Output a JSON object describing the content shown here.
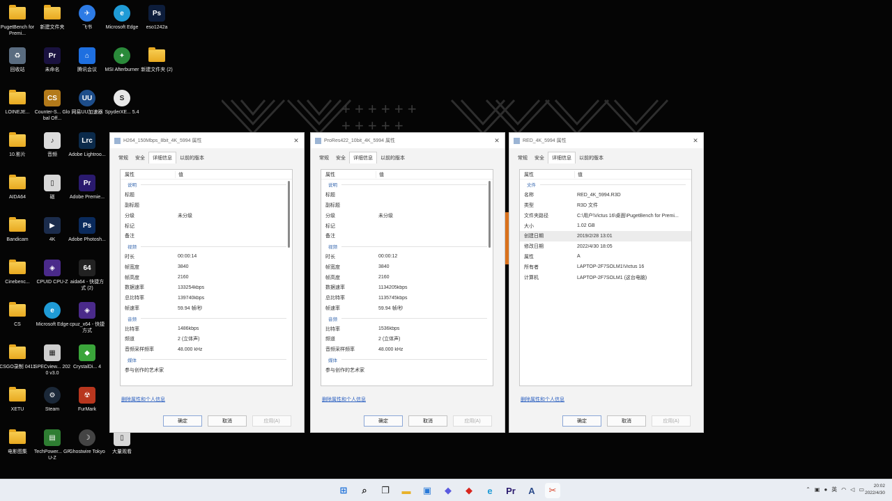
{
  "desktop": {
    "icons": [
      {
        "label": "PugetBench for Premi...",
        "icon": "folder-icon"
      },
      {
        "label": "新建文件夹",
        "icon": "folder-icon"
      },
      {
        "label": "飞书",
        "icon": "feishu-icon"
      },
      {
        "label": "Microsoft Edge",
        "icon": "edge-icon"
      },
      {
        "label": "eso1242a",
        "icon": "photoshop-file-icon"
      },
      {
        "label": "回收站",
        "icon": "recycle-bin-icon"
      },
      {
        "label": "未命名",
        "icon": "premiere-file-icon"
      },
      {
        "label": "腾讯会议",
        "icon": "tencent-meeting-icon"
      },
      {
        "label": "MSI Afterburner",
        "icon": "afterburner-icon"
      },
      {
        "label": "新建文件夹 (2)",
        "icon": "folder-icon"
      },
      {
        "label": "LOINEJE...",
        "icon": "folder-icon"
      },
      {
        "label": "Counter-S... Global Off...",
        "icon": "csgo-icon"
      },
      {
        "label": "网易UU加速器",
        "icon": "uu-accelerator-icon"
      },
      {
        "label": "SpyderXE... 5.4",
        "icon": "spyder-icon"
      },
      {
        "label": "10.影片",
        "icon": "folder-icon"
      },
      {
        "label": "音频",
        "icon": "audio-file-icon"
      },
      {
        "label": "Adobe Lightroo...",
        "icon": "lightroom-icon"
      },
      {
        "label": "AIDA64",
        "icon": "folder-icon"
      },
      {
        "label": "磁",
        "icon": "file-icon"
      },
      {
        "label": "Adobe Premie...",
        "icon": "premiere-icon"
      },
      {
        "label": "Bandicam",
        "icon": "folder-icon"
      },
      {
        "label": "4K",
        "icon": "video-file-icon"
      },
      {
        "label": "Adobe Photosh...",
        "icon": "photoshop-icon"
      },
      {
        "label": "Cinebenc...",
        "icon": "folder-icon"
      },
      {
        "label": "CPUID CPU-Z",
        "icon": "cpuz-icon"
      },
      {
        "label": "aida64 - 快捷方式 (2)",
        "icon": "aida64-icon"
      },
      {
        "label": "CS",
        "icon": "folder-icon"
      },
      {
        "label": "Microsoft Edge",
        "icon": "edge-icon"
      },
      {
        "label": "cpuz_x64 - 快捷方式",
        "icon": "cpuz-icon"
      },
      {
        "label": "CSGO录制 0411",
        "icon": "folder-icon"
      },
      {
        "label": "SPECview... 2020 v3.0",
        "icon": "specview-icon"
      },
      {
        "label": "CrystalDi... 4",
        "icon": "crystaldisk-icon"
      },
      {
        "label": "XETU",
        "icon": "folder-icon"
      },
      {
        "label": "Steam",
        "icon": "steam-icon"
      },
      {
        "label": "FurMark",
        "icon": "furmark-icon"
      },
      {
        "label": "电影图集",
        "icon": "folder-icon"
      },
      {
        "label": "TechPower... GPU-Z",
        "icon": "gpuz-icon"
      },
      {
        "label": "Ghostwire Tokyo",
        "icon": "ghostwire-icon"
      },
      {
        "label": "大量观看",
        "icon": "file-icon"
      }
    ]
  },
  "dialogs": [
    {
      "title": "H264_150Mbps_8bit_4K_5994 属性",
      "tabs": [
        "常规",
        "安全",
        "详细信息",
        "以前的版本"
      ],
      "active_tab": 2,
      "header": {
        "property": "属性",
        "value": "值"
      },
      "rows": [
        {
          "type": "section",
          "label": "说明"
        },
        {
          "k": "标题",
          "v": ""
        },
        {
          "k": "副标题",
          "v": ""
        },
        {
          "k": "分级",
          "v": "未分级"
        },
        {
          "k": "标记",
          "v": ""
        },
        {
          "k": "备注",
          "v": ""
        },
        {
          "type": "section",
          "label": "视频"
        },
        {
          "k": "时长",
          "v": "00:00:14"
        },
        {
          "k": "帧宽度",
          "v": "3840"
        },
        {
          "k": "帧高度",
          "v": "2160"
        },
        {
          "k": "数据速率",
          "v": "133254kbps"
        },
        {
          "k": "总比特率",
          "v": "139740kbps"
        },
        {
          "k": "帧速率",
          "v": "59.94 帧/秒"
        },
        {
          "type": "section",
          "label": "音频"
        },
        {
          "k": "比特率",
          "v": "1486kbps"
        },
        {
          "k": "频道",
          "v": "2 (立体声)"
        },
        {
          "k": "音频采样频率",
          "v": "48.000 kHz"
        },
        {
          "type": "section",
          "label": "媒体"
        },
        {
          "k": "参与创作的艺术家",
          "v": ""
        }
      ],
      "link": "删除属性和个人信息",
      "buttons": {
        "ok": "确定",
        "cancel": "取消",
        "apply": "应用(A)"
      }
    },
    {
      "title": "ProRes422_10bit_4K_5994 属性",
      "tabs": [
        "常规",
        "安全",
        "详细信息",
        "以前的版本"
      ],
      "active_tab": 2,
      "header": {
        "property": "属性",
        "value": "值"
      },
      "rows": [
        {
          "type": "section",
          "label": "说明"
        },
        {
          "k": "标题",
          "v": ""
        },
        {
          "k": "副标题",
          "v": ""
        },
        {
          "k": "分级",
          "v": "未分级"
        },
        {
          "k": "标记",
          "v": ""
        },
        {
          "k": "备注",
          "v": ""
        },
        {
          "type": "section",
          "label": "视频"
        },
        {
          "k": "时长",
          "v": "00:00:12"
        },
        {
          "k": "帧宽度",
          "v": "3840"
        },
        {
          "k": "帧高度",
          "v": "2160"
        },
        {
          "k": "数据速率",
          "v": "1134205kbps"
        },
        {
          "k": "总比特率",
          "v": "1135745kbps"
        },
        {
          "k": "帧速率",
          "v": "59.94 帧/秒"
        },
        {
          "type": "section",
          "label": "音频"
        },
        {
          "k": "比特率",
          "v": "1536kbps"
        },
        {
          "k": "频道",
          "v": "2 (立体声)"
        },
        {
          "k": "音频采样频率",
          "v": "48.000 kHz"
        },
        {
          "type": "section",
          "label": "媒体"
        },
        {
          "k": "参与创作的艺术家",
          "v": ""
        }
      ],
      "link": "删除属性和个人信息",
      "buttons": {
        "ok": "确定",
        "cancel": "取消",
        "apply": "应用(A)"
      }
    },
    {
      "title": "RED_4K_5994 属性",
      "tabs": [
        "常规",
        "安全",
        "详细信息",
        "以前的版本"
      ],
      "active_tab": 2,
      "header": {
        "property": "属性",
        "value": "值"
      },
      "rows": [
        {
          "type": "section",
          "label": "文件"
        },
        {
          "k": "名称",
          "v": "RED_4K_5994.R3D"
        },
        {
          "k": "类型",
          "v": "R3D 文件"
        },
        {
          "k": "文件夹路径",
          "v": "C:\\用户\\Victus 16\\桌面\\PugetBench for Premi..."
        },
        {
          "k": "大小",
          "v": "1.02 GB"
        },
        {
          "k": "创建日期",
          "v": "2019/2/28 13:01",
          "selected": true
        },
        {
          "k": "修改日期",
          "v": "2022/4/30 18:05"
        },
        {
          "k": "属性",
          "v": "A"
        },
        {
          "k": "所有者",
          "v": "LAPTOP-2F7SOLM1\\Victus 16"
        },
        {
          "k": "计算机",
          "v": "LAPTOP-2F7SOLM1 (这台电脑)"
        }
      ],
      "link": "删除属性和个人信息",
      "buttons": {
        "ok": "确定",
        "cancel": "取消",
        "apply": "应用(A)"
      }
    }
  ],
  "taskbar": {
    "pinned": [
      {
        "icon": "windows-start-icon"
      },
      {
        "icon": "search-icon"
      },
      {
        "icon": "task-view-icon"
      },
      {
        "icon": "file-explorer-icon"
      },
      {
        "icon": "store-icon"
      },
      {
        "icon": "chat-icon"
      },
      {
        "icon": "red-app-icon"
      },
      {
        "icon": "edge-icon"
      },
      {
        "icon": "premiere-icon"
      },
      {
        "icon": "aida64-icon"
      },
      {
        "icon": "snipping-tool-icon"
      }
    ],
    "clock": {
      "time": "20:02",
      "date": "2022/4/30"
    }
  },
  "colors": {
    "folder": "#f2bd3c",
    "accent": "#2a5fc0",
    "wallpaper": "#050505",
    "orange_accent": "#d9711c"
  }
}
